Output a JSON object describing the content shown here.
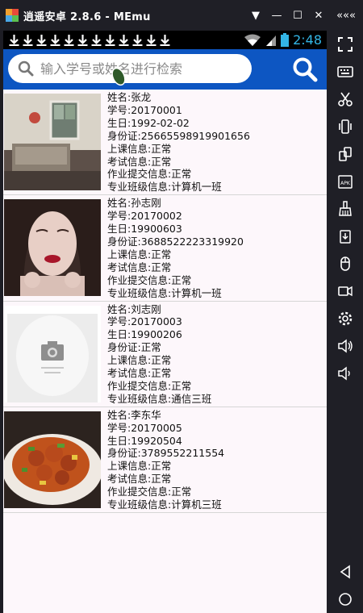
{
  "window": {
    "title": "逍遥安卓 2.8.6 - MEmu",
    "controls": [
      "▼",
      "—",
      "☐",
      "✕",
      "«««"
    ]
  },
  "status_bar": {
    "time": "2:48",
    "download_icon_count": 12
  },
  "search": {
    "placeholder": "输入学号或姓名进行检索"
  },
  "students": [
    {
      "name": "姓名:张龙",
      "id": "学号:20170001",
      "birthday": "生日:1992-02-02",
      "id_card": "身份证:25665598919901656",
      "class_info": "上课信息:正常",
      "exam_info": "考试信息:正常",
      "homework_info": "作业提交信息:正常",
      "major_class": "专业班级信息:计算机一班",
      "photo": "room-photo"
    },
    {
      "name": "姓名:孙志刚",
      "id": "学号:20170002",
      "birthday": "生日:19900603",
      "id_card": "身份证:3688522223319920",
      "class_info": "上课信息:正常",
      "exam_info": "考试信息:正常",
      "homework_info": "作业提交信息:正常",
      "major_class": "专业班级信息:计算机一班",
      "photo": "woman-portrait"
    },
    {
      "name": "姓名:刘志刚",
      "id": "学号:20170003",
      "birthday": "生日:19900206",
      "id_card": "身份证:正常",
      "class_info": "上课信息:正常",
      "exam_info": "考试信息:正常",
      "homework_info": "作业提交信息:正常",
      "major_class": "专业班级信息:通信三班",
      "photo": "camera-placeholder"
    },
    {
      "name": "姓名:李东华",
      "id": "学号:20170005",
      "birthday": "生日:19920504",
      "id_card": "身份证:3789552211554",
      "class_info": "上课信息:正常",
      "exam_info": "考试信息:正常",
      "homework_info": "作业提交信息:正常",
      "major_class": "专业班级信息:计算机三班",
      "photo": "food-dish"
    }
  ],
  "emulator_toolbar": [
    "fullscreen-icon",
    "keyboard-icon",
    "scissors-icon",
    "shake-icon",
    "rotate-icon",
    "apk-icon",
    "broom-icon",
    "share-icon",
    "mouse-icon",
    "screen-record-icon",
    "settings-icon",
    "volume-up-icon",
    "volume-down-icon",
    "back-icon",
    "home-icon"
  ],
  "colors": {
    "search_bar": "#0d56c2",
    "clock": "#33b5e5",
    "emulator_frame": "#1f1f26"
  }
}
